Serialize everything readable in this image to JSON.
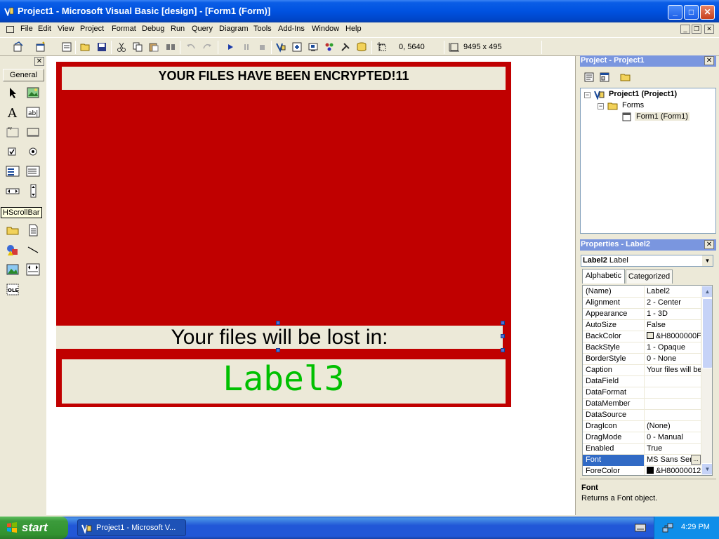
{
  "window": {
    "title": "Project1 - Microsoft Visual Basic [design] - [Form1 (Form)]"
  },
  "menubar": {
    "items": [
      "File",
      "Edit",
      "View",
      "Project",
      "Format",
      "Debug",
      "Run",
      "Query",
      "Diagram",
      "Tools",
      "Add-Ins",
      "Window",
      "Help"
    ]
  },
  "toolbar": {
    "position_readout": "0, 5640",
    "size_readout": "9495 x 495"
  },
  "toolbox": {
    "tab_label": "General",
    "tooltip": "HScrollBar"
  },
  "form": {
    "label1_caption": "YOUR FILES HAVE BEEN ENCRYPTED!11",
    "label2_caption": "Your files will be lost in:",
    "label3_caption": "Label3"
  },
  "project_explorer": {
    "title": "Project - Project1",
    "project_node": "Project1 (Project1)",
    "folder_node": "Forms",
    "form_node": "Form1 (Form1)"
  },
  "properties": {
    "title": "Properties - Label2",
    "object_name": "Label2",
    "object_type": "Label",
    "tabs": [
      "Alphabetic",
      "Categorized"
    ],
    "rows": [
      {
        "name": "(Name)",
        "value": "Label2"
      },
      {
        "name": "Alignment",
        "value": "2 - Center"
      },
      {
        "name": "Appearance",
        "value": "1 - 3D"
      },
      {
        "name": "AutoSize",
        "value": "False"
      },
      {
        "name": "BackColor",
        "value": "&H8000000F"
      },
      {
        "name": "BackStyle",
        "value": "1 - Opaque"
      },
      {
        "name": "BorderStyle",
        "value": "0 - None"
      },
      {
        "name": "Caption",
        "value": "Your files will be"
      },
      {
        "name": "DataField",
        "value": ""
      },
      {
        "name": "DataFormat",
        "value": ""
      },
      {
        "name": "DataMember",
        "value": ""
      },
      {
        "name": "DataSource",
        "value": ""
      },
      {
        "name": "DragIcon",
        "value": "(None)"
      },
      {
        "name": "DragMode",
        "value": "0 - Manual"
      },
      {
        "name": "Enabled",
        "value": "True"
      },
      {
        "name": "Font",
        "value": "MS Sans Serif"
      },
      {
        "name": "ForeColor",
        "value": "&H80000012"
      }
    ],
    "description_title": "Font",
    "description_text": "Returns a Font object."
  },
  "taskbar": {
    "start_label": "start",
    "task_label": "Project1 - Microsoft V...",
    "clock": "4:29 PM"
  },
  "colors": {
    "form_backcolor": "#c00000",
    "label_backcolor": "#ece9d8",
    "label3_forecolor": "#00c000",
    "backcolor_swatch": "#ece9d8",
    "forecolor_swatch": "#000000"
  }
}
